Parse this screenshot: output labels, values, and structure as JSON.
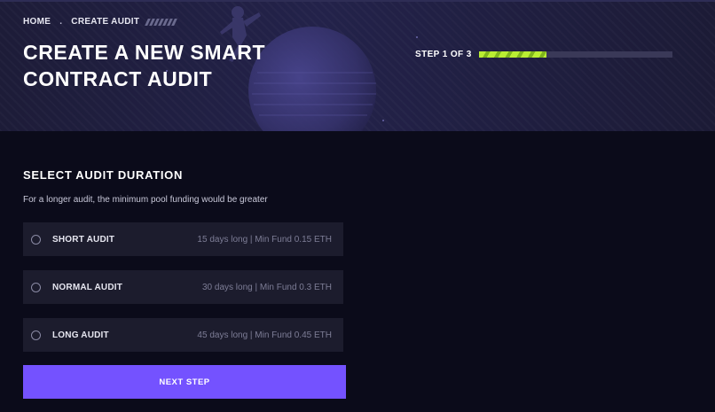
{
  "breadcrumb": {
    "home": "HOME",
    "separator": ".",
    "current": "CREATE AUDIT"
  },
  "header": {
    "title": "CREATE A NEW SMART CONTRACT AUDIT",
    "step_label": "STEP 1 OF 3",
    "progress_fraction": 0.35
  },
  "section": {
    "title": "SELECT AUDIT DURATION",
    "description": "For a longer audit, the minimum pool funding would be greater"
  },
  "options": [
    {
      "label": "SHORT AUDIT",
      "meta": "15 days long | Min Fund 0.15 ETH",
      "selected": false
    },
    {
      "label": "NORMAL AUDIT",
      "meta": "30 days long | Min Fund 0.3 ETH",
      "selected": false
    },
    {
      "label": "LONG AUDIT",
      "meta": "45 days long | Min Fund 0.45 ETH",
      "selected": false
    }
  ],
  "actions": {
    "next_label": "NEXT STEP"
  },
  "colors": {
    "accent": "#7452ff",
    "progress": "#b9ee33",
    "background": "#0b0b1a",
    "hero": "#23224a",
    "option_bg": "#1c1c2d"
  }
}
